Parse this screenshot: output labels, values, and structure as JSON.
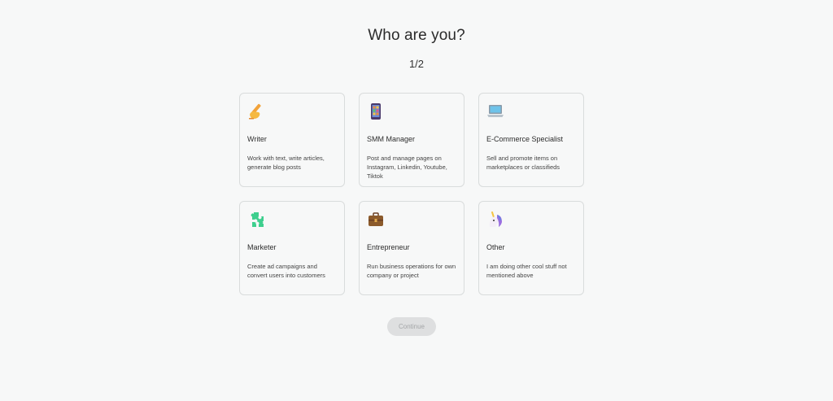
{
  "header": {
    "title": "Who are you?",
    "step": "1/2"
  },
  "roles": [
    {
      "icon": "writing-hand-icon",
      "name": "Writer",
      "description": "Work with text, write articles, generate blog posts"
    },
    {
      "icon": "mobile-phone-icon",
      "name": "SMM Manager",
      "description": "Post and manage pages on Instagram, Linkedin, Youtube, Tiktok"
    },
    {
      "icon": "laptop-icon",
      "name": "E-Commerce Specialist",
      "description": "Sell and promote items on marketplaces or classifieds"
    },
    {
      "icon": "puzzle-piece-icon",
      "name": "Marketer",
      "description": "Create ad campaigns and convert users into customers"
    },
    {
      "icon": "briefcase-icon",
      "name": "Entrepreneur",
      "description": "Run business operations for own company or project"
    },
    {
      "icon": "unicorn-icon",
      "name": "Other",
      "description": "I am doing other cool stuff not mentioned above"
    }
  ],
  "footer": {
    "continue_label": "Continue",
    "continue_disabled": true
  }
}
